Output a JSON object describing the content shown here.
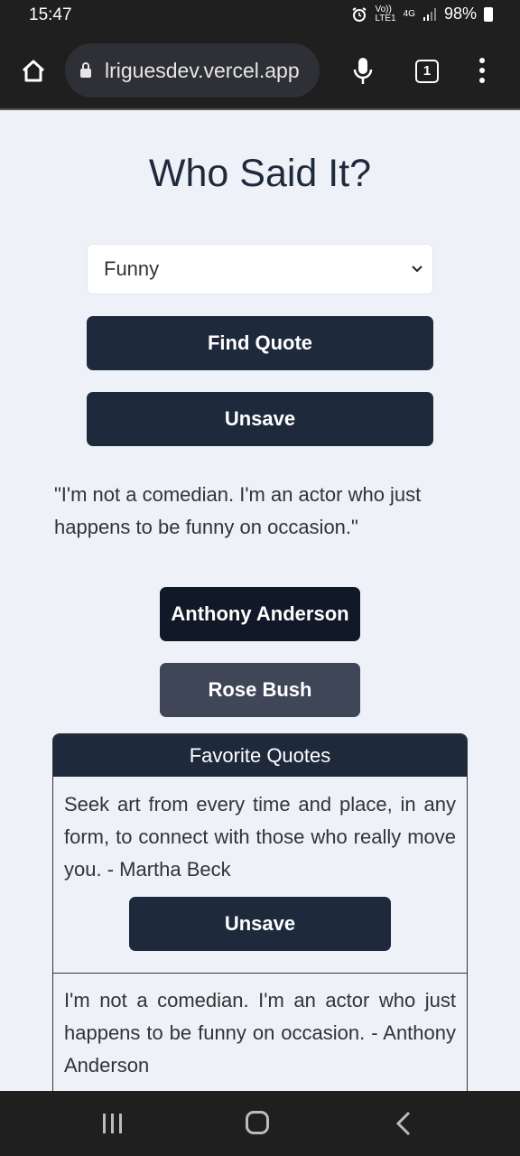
{
  "status_bar": {
    "time": "15:47",
    "network_top": "Vo))",
    "network_bottom": "LTE1",
    "signal": "4G",
    "battery": "98%"
  },
  "browser": {
    "url": "lriguesdev.vercel.app",
    "tab_count": "1"
  },
  "page": {
    "title": "Who Said It?",
    "category_select": "Funny",
    "find_button": "Find Quote",
    "unsave_button": "Unsave",
    "current_quote": "\"I'm not a comedian. I'm an actor who just happens to be funny on occasion.\"",
    "choices": [
      "Anthony Anderson",
      "Rose Bush"
    ]
  },
  "favorites": {
    "heading": "Favorite Quotes",
    "items": [
      {
        "text": "Seek art from every time and place, in any form, to connect with those who really move you. - Martha Beck",
        "button": "Unsave"
      },
      {
        "text": "I'm not a comedian. I'm an actor who just happens to be funny on occasion. - Anthony Anderson"
      }
    ]
  },
  "icons": {
    "home": "home-icon",
    "lock": "lock-icon",
    "mic": "microphone-icon",
    "tabs": "tabs-icon",
    "menu": "more-vert-icon",
    "chevron": "chevron-down-icon",
    "recents": "recents-icon",
    "nav_home": "nav-home-icon",
    "back": "back-icon"
  }
}
